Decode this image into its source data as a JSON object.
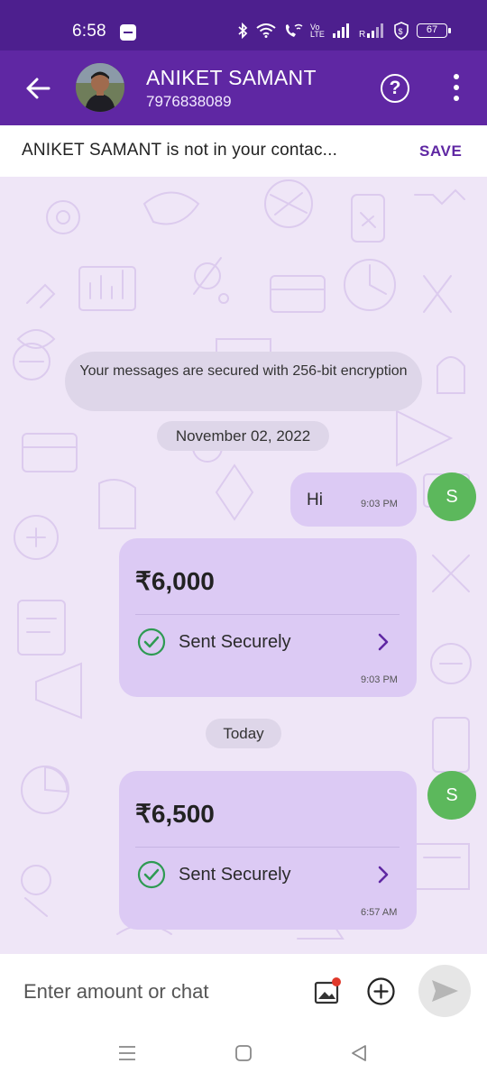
{
  "status_bar": {
    "time": "6:58",
    "battery": "67",
    "network_label": "Vo LTE",
    "icons": [
      "bluetooth-icon",
      "wifi-icon",
      "wifi-call-icon",
      "volte-icon",
      "signal-icon",
      "signal-icon",
      "vpn-icon",
      "battery-icon"
    ]
  },
  "header": {
    "contact_name": "ANIKET SAMANT",
    "contact_phone": "7976838089",
    "help_label": "?",
    "colors": {
      "status_bar": "#4d1f8e",
      "app_bar": "#5f27a3"
    }
  },
  "banner": {
    "text": "ANIKET SAMANT is not in your contac...",
    "save_label": "SAVE"
  },
  "chat": {
    "encryption_notice": "Your messages are secured with 256-bit encryption",
    "date_divider_1": "November 02, 2022",
    "date_divider_2": "Today",
    "sender_initial": "S",
    "messages": [
      {
        "type": "text",
        "text": "Hi",
        "time": "9:03 PM"
      },
      {
        "type": "payment",
        "amount": "₹6,000",
        "status": "Sent Securely",
        "time": "9:03 PM"
      },
      {
        "type": "payment",
        "amount": "₹6,500",
        "status": "Sent Securely",
        "time": "6:57 AM"
      }
    ],
    "colors": {
      "background": "#efe6f7",
      "bubble": "#dccaf4",
      "avatar": "#5cb85c",
      "check": "#2e9a52"
    }
  },
  "input": {
    "placeholder": "Enter amount or chat"
  }
}
